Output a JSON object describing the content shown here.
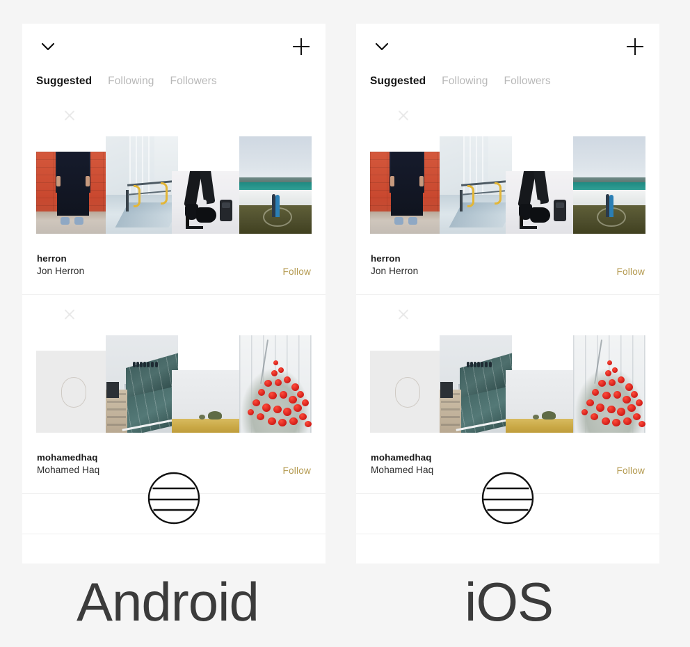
{
  "meta": {
    "canvas_bg": "#f5f5f5",
    "card_bg": "#ffffff",
    "accent_follow": "#b49a50",
    "text_primary": "#1a1a1a",
    "text_muted": "#b8b8b8",
    "divider": "#f0f0f0"
  },
  "captions": {
    "android": "Android",
    "ios": "iOS"
  },
  "screen": {
    "topbar": {
      "chevron_icon": "chevron-down-icon",
      "plus_icon": "plus-icon"
    },
    "tabs": [
      {
        "label": "Suggested",
        "active": true
      },
      {
        "label": "Following",
        "active": false
      },
      {
        "label": "Followers",
        "active": false
      }
    ],
    "suggestions": [
      {
        "handle": "herron",
        "fullname": "Jon Herron",
        "follow_label": "Follow",
        "dismiss_icon": "close-icon",
        "photos": [
          {
            "name": "photo-person-red-brick-wall"
          },
          {
            "name": "photo-industrial-ramp"
          },
          {
            "name": "photo-black-shoes-studio"
          },
          {
            "name": "photo-beach-couple"
          }
        ]
      },
      {
        "handle": "mohamedhaq",
        "fullname": "Mohamed Haq",
        "follow_label": "Follow",
        "dismiss_icon": "close-icon",
        "photos": [
          {
            "name": "photo-placeholder-empty"
          },
          {
            "name": "photo-glass-rooftop-building"
          },
          {
            "name": "photo-pale-field-horizon"
          },
          {
            "name": "photo-red-flowers-siding"
          }
        ]
      }
    ],
    "globe_badge_icon": "globe-icon"
  }
}
